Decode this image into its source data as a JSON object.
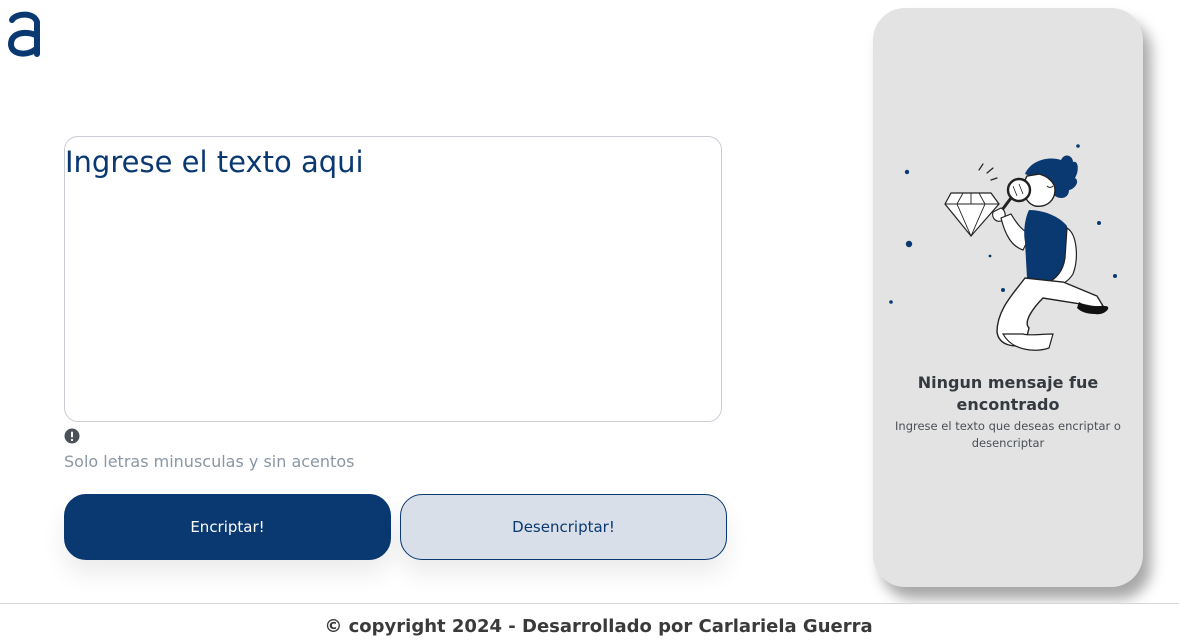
{
  "app": {
    "logo_icon": "alura-a-logo-icon",
    "accent_color": "#0a3871"
  },
  "input": {
    "placeholder": "Ingrese el texto aqui",
    "value": ""
  },
  "hint": {
    "icon": "exclamation-circle-icon",
    "text": "Solo letras minusculas y sin acentos"
  },
  "buttons": {
    "encrypt_label": "Encriptar!",
    "decrypt_label": "Desencriptar!"
  },
  "result_panel": {
    "illustration": "person-with-magnifying-glass-and-diamond-illustration",
    "title_line1": "Ningun mensaje fue",
    "title_line2": "encontrado",
    "subtitle": "Ingrese el texto que deseas encriptar o desencriptar"
  },
  "footer": {
    "text": "© copyright 2024 - Desarrollado por Carlariela Guerra"
  }
}
